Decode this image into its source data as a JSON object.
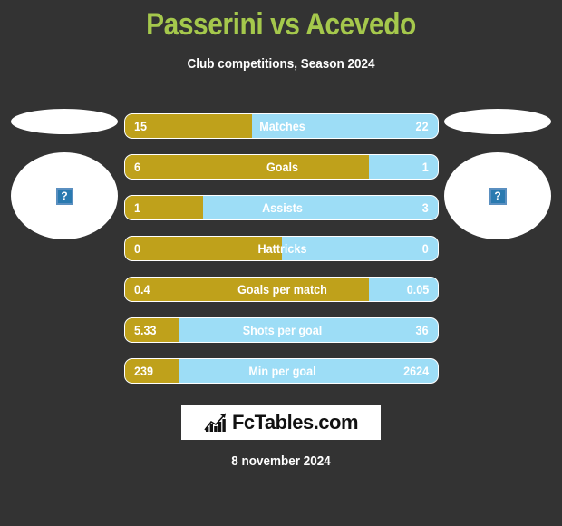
{
  "header": {
    "title": "Passerini vs Acevedo",
    "subtitle": "Club competitions, Season 2024",
    "title_color": "#A5C84C"
  },
  "players": {
    "left": {
      "avatar_state": "broken-image",
      "color": "#BFA11B"
    },
    "right": {
      "avatar_state": "broken-image",
      "color": "#9DDDF6"
    }
  },
  "chart_data": {
    "type": "bar",
    "title": "Passerini vs Acevedo",
    "subtitle": "Club competitions, Season 2024",
    "orientation": "horizontal-diverging",
    "series": [
      {
        "name": "Passerini",
        "color": "#BFA11B",
        "side": "left"
      },
      {
        "name": "Acevedo",
        "color": "#9DDDF6",
        "side": "right"
      }
    ],
    "categories": [
      "Matches",
      "Goals",
      "Assists",
      "Hattricks",
      "Goals per match",
      "Shots per goal",
      "Min per goal"
    ],
    "left_values": [
      "15",
      "6",
      "1",
      "0",
      "0.4",
      "5.33",
      "239"
    ],
    "right_values": [
      "22",
      "1",
      "3",
      "0",
      "0.05",
      "36",
      "2624"
    ],
    "left_pct": [
      40.5,
      78,
      25,
      50,
      78,
      17,
      17
    ]
  },
  "rows": [
    {
      "label": "Matches",
      "left": "15",
      "right": "22",
      "pct": 40.5
    },
    {
      "label": "Goals",
      "left": "6",
      "right": "1",
      "pct": 78
    },
    {
      "label": "Assists",
      "left": "1",
      "right": "3",
      "pct": 25
    },
    {
      "label": "Hattricks",
      "left": "0",
      "right": "0",
      "pct": 50
    },
    {
      "label": "Goals per match",
      "left": "0.4",
      "right": "0.05",
      "pct": 78
    },
    {
      "label": "Shots per goal",
      "left": "5.33",
      "right": "36",
      "pct": 17
    },
    {
      "label": "Min per goal",
      "left": "239",
      "right": "2624",
      "pct": 17
    }
  ],
  "logo": {
    "text": "FcTables.com",
    "icon": "bar-chart-growth-icon"
  },
  "footer": {
    "date": "8 november 2024"
  },
  "colors": {
    "background": "#333333",
    "left_bar": "#BFA11B",
    "right_bar": "#9DDDF6",
    "title": "#A5C84C",
    "text": "#FFFFFF"
  }
}
